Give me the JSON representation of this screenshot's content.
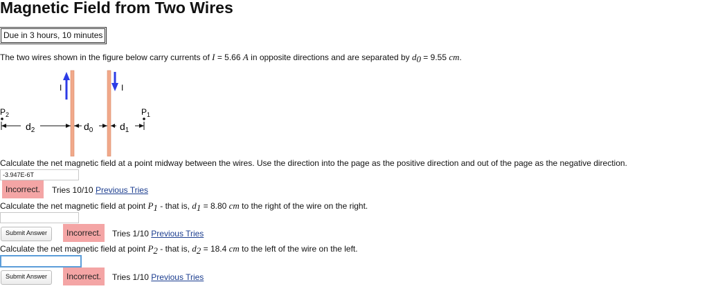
{
  "title": "Magnetic Field from Two Wires",
  "due": "Due in 3 hours, 10 minutes",
  "problem": {
    "pre": "The two wires shown in the figure below carry currents of ",
    "I_sym": "I",
    "mid1": " = 5.66 ",
    "A_unit": "A",
    "mid2": " in opposite directions and are separated by ",
    "d_sym": "d",
    "d_sub": "0",
    "mid3": " = 9.55 ",
    "cm_unit": "cm",
    "end": "."
  },
  "figure": {
    "current_label_left": "I",
    "current_label_right": "I",
    "p2": "P",
    "p2_sub": "2",
    "p1": "P",
    "p1_sub": "1",
    "d2": "d",
    "d2_sub": "2",
    "d0": "d",
    "d0_sub": "0",
    "d1": "d",
    "d1_sub": "1",
    "colors": {
      "wire": "#f1a98a",
      "arrow": "#2c3ce6"
    }
  },
  "q1": {
    "prompt": "Calculate the net magnetic field at a point midway between the wires. Use the direction into the page as the positive direction and out of the page as the negative direction.",
    "answer": "-3.947E-6T",
    "result": "Incorrect.",
    "tries": "Tries 10/10",
    "link": "Previous Tries"
  },
  "q2": {
    "pre": "Calculate the net magnetic field at point ",
    "P": "P",
    "P_sub": "1",
    "mid": " - that is, ",
    "d": "d",
    "d_sub": "1",
    "val": " = 8.80 ",
    "unit": "cm",
    "end": " to the right of the wire on the right.",
    "answer": "",
    "submit": "Submit Answer",
    "result": "Incorrect.",
    "tries": "Tries 1/10",
    "link": "Previous Tries"
  },
  "q3": {
    "pre": "Calculate the net magnetic field at point ",
    "P": "P",
    "P_sub": "2",
    "mid": " - that is, ",
    "d": "d",
    "d_sub": "2",
    "val": " = 18.4 ",
    "unit": "cm",
    "end": " to the left of the wire on the left.",
    "answer": "",
    "submit": "Submit Answer",
    "result": "Incorrect.",
    "tries": "Tries 1/10",
    "link": "Previous Tries"
  }
}
